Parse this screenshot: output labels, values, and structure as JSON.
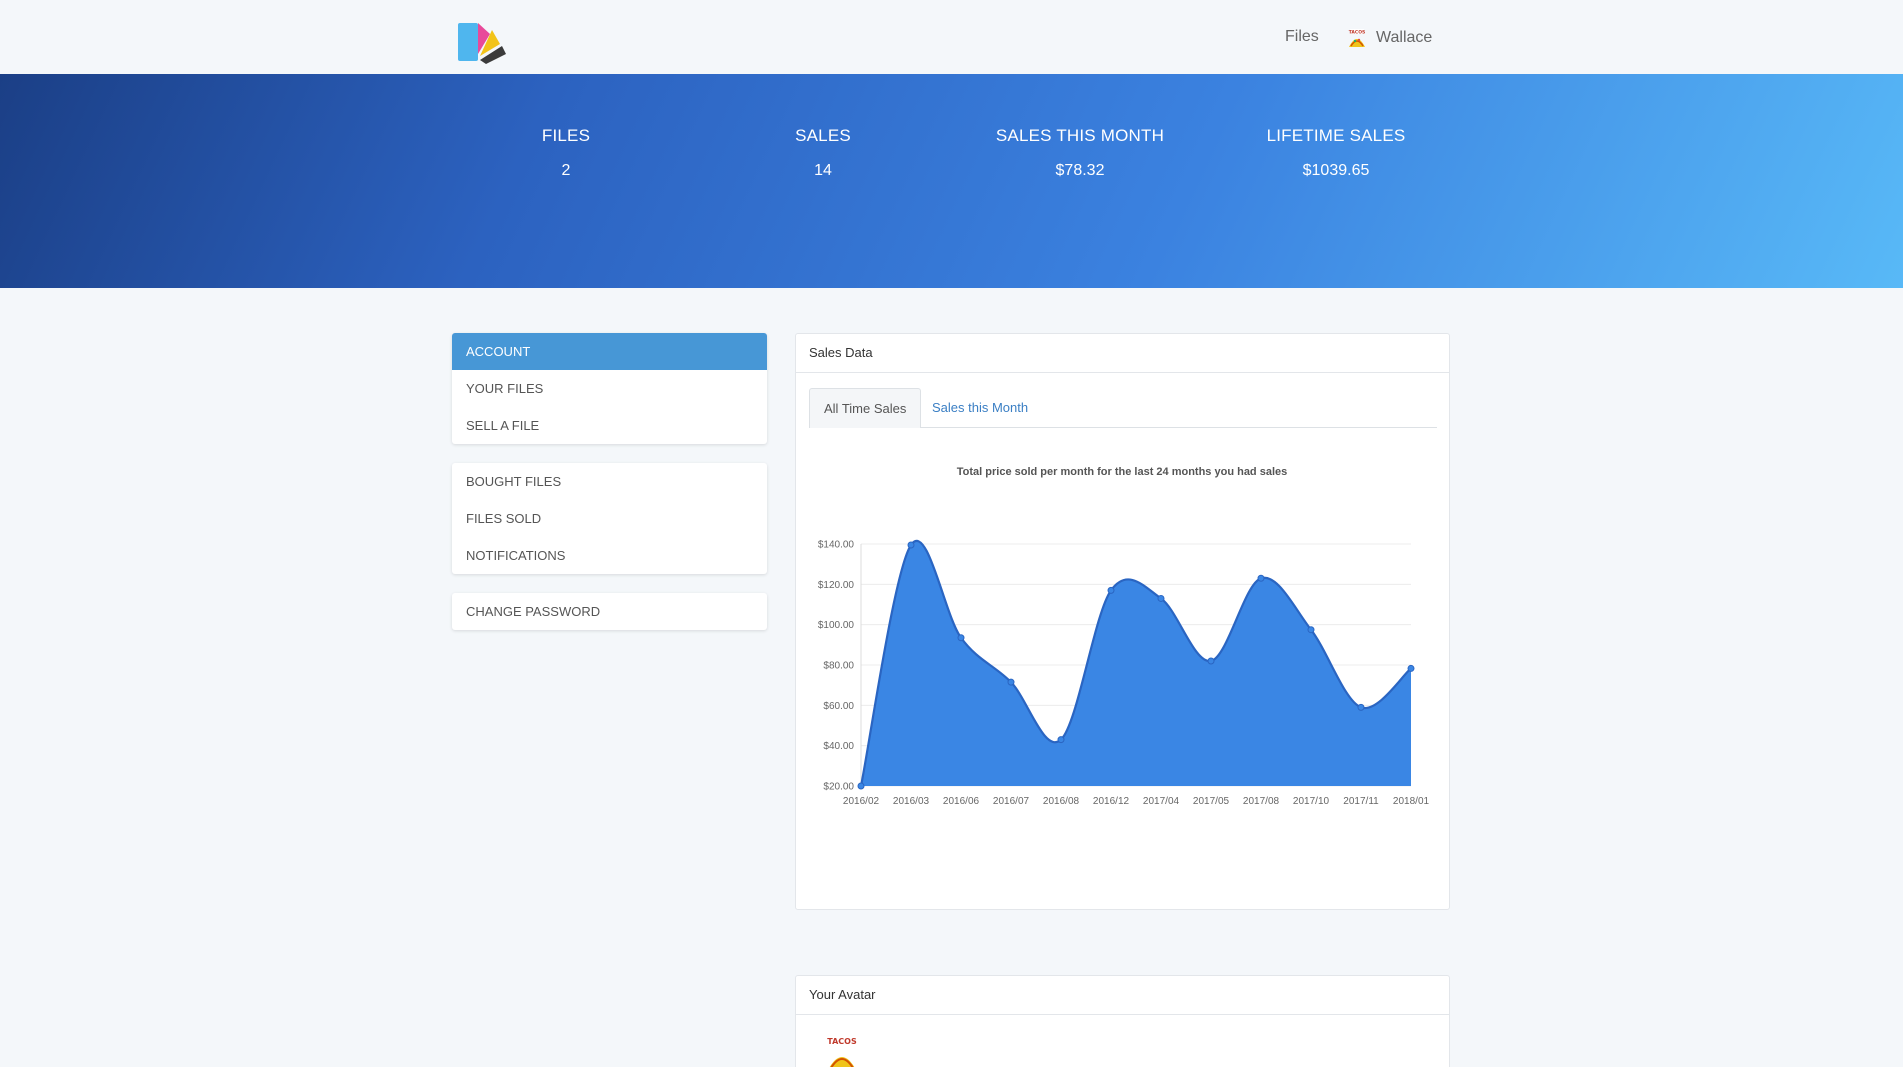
{
  "nav": {
    "files_label": "Files",
    "user_name": "Wallace",
    "avatar_text": "TACOS"
  },
  "stats": [
    {
      "label": "FILES",
      "value": "2"
    },
    {
      "label": "SALES",
      "value": "14"
    },
    {
      "label": "SALES THIS MONTH",
      "value": "$78.32"
    },
    {
      "label": "LIFETIME SALES",
      "value": "$1039.65"
    }
  ],
  "sidebar": {
    "group1": [
      "ACCOUNT",
      "YOUR FILES",
      "SELL A FILE"
    ],
    "group2": [
      "BOUGHT FILES",
      "FILES SOLD",
      "NOTIFICATIONS"
    ],
    "group3": [
      "CHANGE PASSWORD"
    ],
    "active": "ACCOUNT"
  },
  "sales_panel": {
    "title": "Sales Data",
    "tabs": [
      "All Time Sales",
      "Sales this Month"
    ],
    "active_tab": "All Time Sales"
  },
  "avatar_panel": {
    "title": "Your Avatar"
  },
  "colors": {
    "accent": "#4797d6",
    "area_fill": "#3a86e4",
    "area_line": "#2a65c2",
    "link": "#3b7fc4"
  },
  "chart_data": {
    "type": "area",
    "title": "Total price sold per month for the last 24 months you had sales",
    "x": [
      "2016/02",
      "2016/03",
      "2016/06",
      "2016/07",
      "2016/08",
      "2016/12",
      "2017/04",
      "2017/05",
      "2017/08",
      "2017/10",
      "2017/11",
      "2018/01"
    ],
    "values": [
      20,
      139.5,
      93.5,
      71.5,
      43,
      117,
      113,
      82,
      123,
      97.5,
      59,
      78.3
    ],
    "ylim": [
      20,
      140
    ],
    "yticks": [
      "$140.00",
      "$120.00",
      "$100.00",
      "$80.00",
      "$60.00",
      "$40.00",
      "$20.00"
    ],
    "ytick_values": [
      140,
      120,
      100,
      80,
      60,
      40,
      20
    ],
    "grid": true,
    "smooth": true,
    "xlabel": "",
    "ylabel": ""
  }
}
